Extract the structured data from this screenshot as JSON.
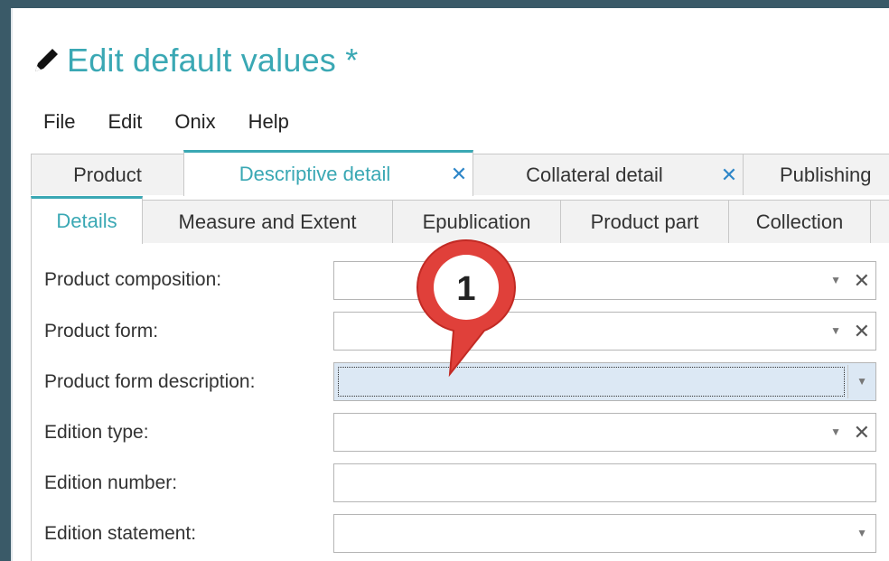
{
  "window": {
    "title": "Edit default values *"
  },
  "menu": [
    "File",
    "Edit",
    "Onix",
    "Help"
  ],
  "main_tabs": [
    {
      "label": "Product",
      "closable": false,
      "active": false
    },
    {
      "label": "Descriptive detail",
      "closable": true,
      "active": true
    },
    {
      "label": "Collateral detail",
      "closable": true,
      "active": false
    },
    {
      "label": "Publishing",
      "closable": false,
      "active": false
    }
  ],
  "sub_tabs": [
    {
      "label": "Details",
      "active": true
    },
    {
      "label": "Measure and Extent",
      "active": false
    },
    {
      "label": "Epublication",
      "active": false
    },
    {
      "label": "Product part",
      "active": false
    },
    {
      "label": "Collection",
      "active": false
    }
  ],
  "fields": [
    {
      "label": "Product composition:",
      "value": "",
      "type": "combo-clearable"
    },
    {
      "label": "Product form:",
      "value": "",
      "type": "combo-clearable"
    },
    {
      "label": "Product form description:",
      "value": "",
      "type": "combo-focused"
    },
    {
      "label": "Edition type:",
      "value": "",
      "type": "combo-clearable"
    },
    {
      "label": "Edition number:",
      "value": "",
      "type": "text"
    },
    {
      "label": "Edition statement:",
      "value": "",
      "type": "combo"
    }
  ],
  "glyphs": {
    "clear": "✕",
    "dropdown": "▼",
    "tab_close": "✕"
  },
  "callout": {
    "number": "1",
    "color": "#e0403a"
  },
  "colors": {
    "accent": "#3aa8b4",
    "frame": "#3a5a68",
    "close": "#2e86c8",
    "focus_bg": "#dce8f4"
  }
}
